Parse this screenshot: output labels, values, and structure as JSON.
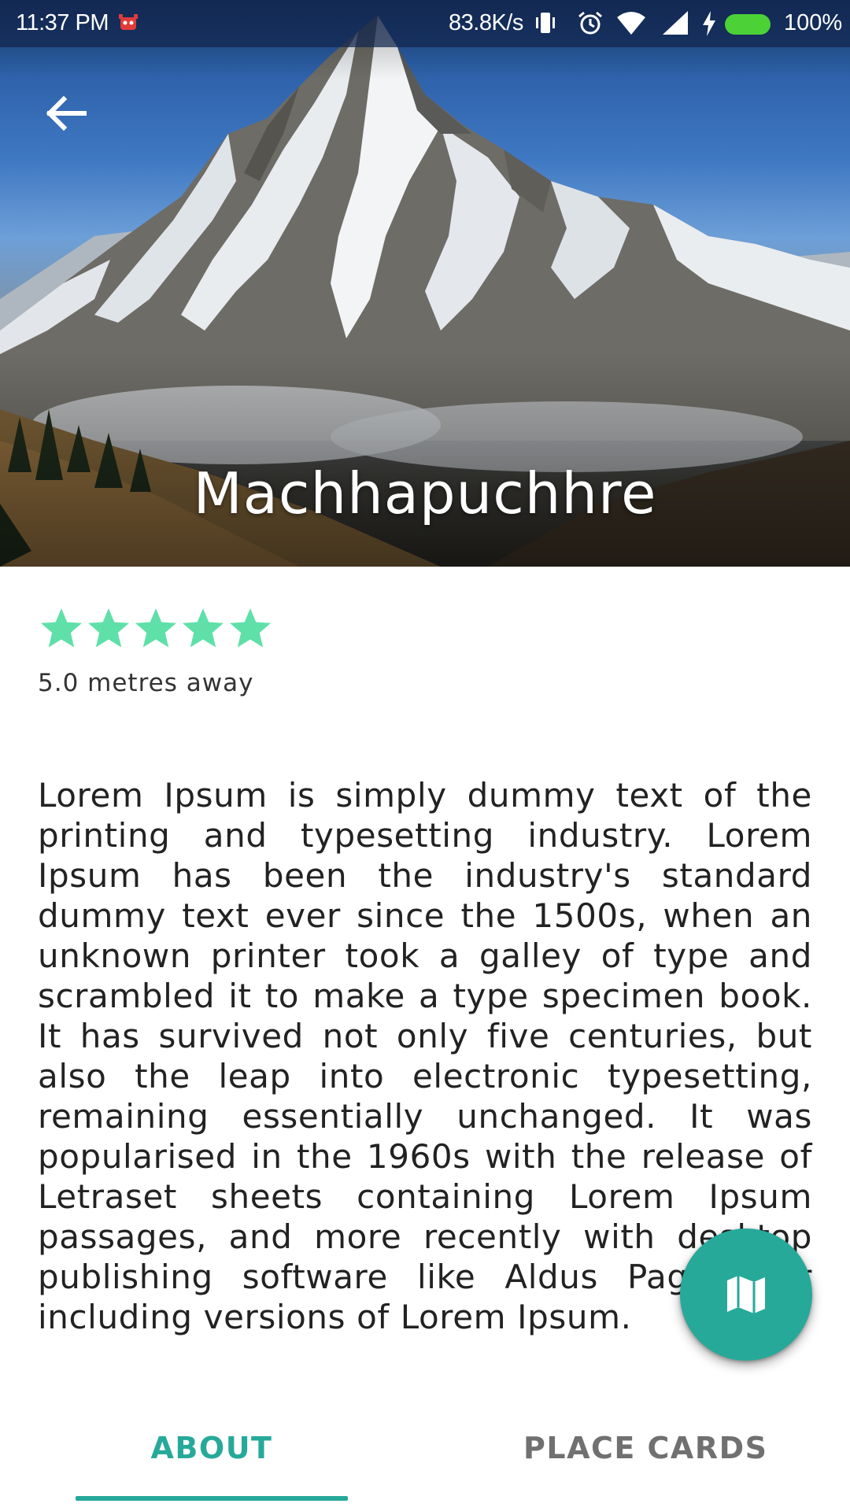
{
  "status_bar": {
    "time": "11:37 PM",
    "net_speed": "83.8K/s",
    "battery": "100%",
    "icons": [
      "carrier-app-icon",
      "vibrate-icon",
      "alarm-icon",
      "wifi-icon",
      "cell-signal-icon",
      "charging-icon",
      "battery-icon"
    ]
  },
  "header": {
    "back_icon": "arrow-left-icon",
    "title": "Machhapuchhre",
    "image": "mountain-photo"
  },
  "rating": {
    "stars": 5,
    "max": 5,
    "star_color": "#5fe0a9"
  },
  "distance": "5.0 metres away",
  "description": "Lorem Ipsum is simply dummy text of the printing and typesetting industry. Lorem Ipsum has been the industry's standard dummy text ever since the 1500s, when an unknown printer took a galley of type and scrambled it to make a type specimen book. It has survived not only five centuries, but also the leap into electronic typesetting, remaining essentially unchanged. It was popularised in the 1960s with the release of Letraset sheets containing Lorem Ipsum passages, and more recently with desktop publishing software like Aldus PageMaker including versions of Lorem Ipsum.",
  "fab": {
    "icon": "map-icon",
    "color": "#27a99a"
  },
  "tabs": [
    {
      "label": "ABOUT",
      "selected": true
    },
    {
      "label": "PLACE CARDS",
      "selected": false
    }
  ],
  "colors": {
    "accent": "#27a99a",
    "tab_inactive": "#707070"
  }
}
